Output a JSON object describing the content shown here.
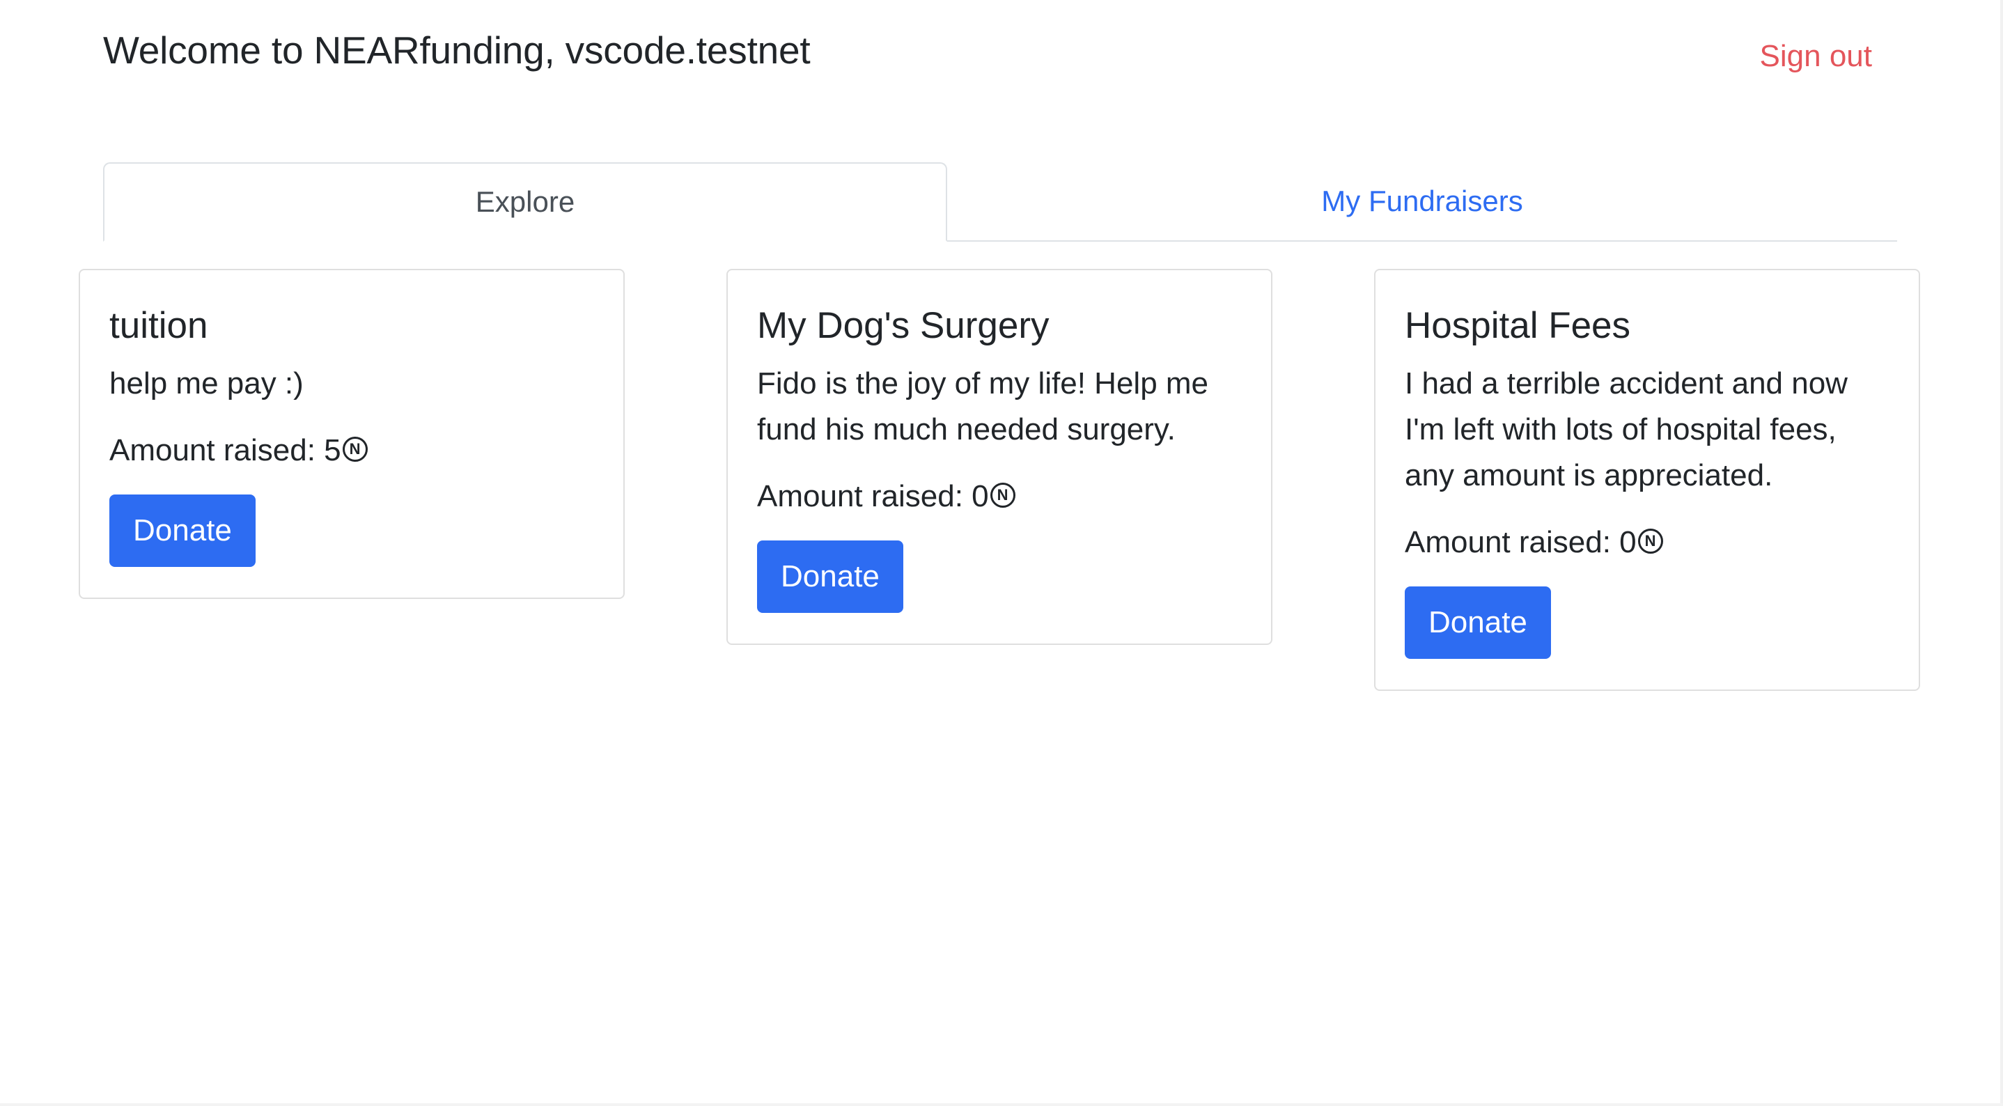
{
  "header": {
    "welcome": "Welcome to NEARfunding, vscode.testnet",
    "sign_out_label": "Sign out"
  },
  "tabs": [
    {
      "label": "Explore",
      "active": true
    },
    {
      "label": "My Fundraisers",
      "active": false
    }
  ],
  "cards": [
    {
      "title": "tuition",
      "description": "help me pay :)",
      "amount_label": "Amount raised: 5",
      "donate_label": "Donate"
    },
    {
      "title": "My Dog's Surgery",
      "description": "Fido is the joy of my life! Help me fund his much needed surgery.",
      "amount_label": "Amount raised: 0",
      "donate_label": "Donate"
    },
    {
      "title": "Hospital Fees",
      "description": "I had a terrible accident and now I'm left with lots of hospital fees, any amount is appreciated.",
      "amount_label": "Amount raised: 0",
      "donate_label": "Donate"
    }
  ],
  "currency_icon": "near-token-icon",
  "colors": {
    "primary": "#2d6cf2",
    "sign_out": "#e4555b",
    "text": "#212529",
    "border": "#dee2e6"
  }
}
